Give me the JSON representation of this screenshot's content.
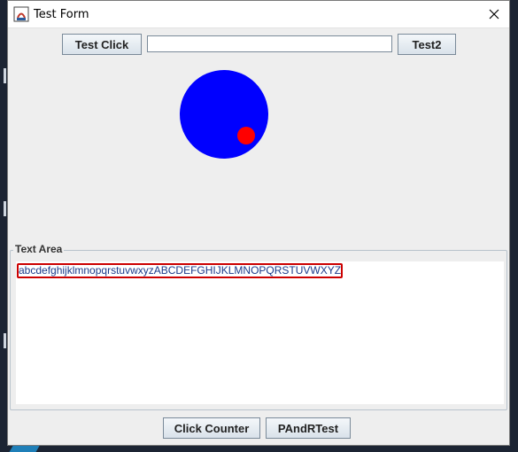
{
  "window": {
    "title": "Test Form"
  },
  "toolbar": {
    "test_click_label": "Test Click",
    "text_field_value": "",
    "test2_label": "Test2"
  },
  "canvas": {
    "big_circle_color": "#0000ff",
    "small_circle_color": "#ff0000"
  },
  "text_area": {
    "group_title": "Text Area",
    "content": "abcdefghijklmnopqrstuvwxyzABCDEFGHIJKLMNOPQRSTUVWXYZ",
    "highlight_color": "#cc0000"
  },
  "bottom_bar": {
    "click_counter_label": "Click Counter",
    "pandr_test_label": "PAndRTest"
  },
  "icons": {
    "app": "java-app-icon",
    "close": "close-icon"
  }
}
